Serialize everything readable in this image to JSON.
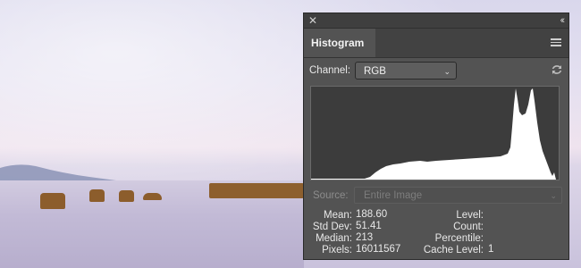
{
  "panel": {
    "tab_title": "Histogram",
    "icons": {
      "close": "close-icon",
      "collapse": "double-chevron-icon",
      "menu": "panel-menu-icon",
      "refresh": "refresh-icon"
    }
  },
  "channel": {
    "label": "Channel:",
    "value": "RGB"
  },
  "source": {
    "label": "Source:",
    "value": "Entire Image"
  },
  "stats_left": [
    {
      "label": "Mean:",
      "value": "188.60"
    },
    {
      "label": "Std Dev:",
      "value": "51.41"
    },
    {
      "label": "Median:",
      "value": "213"
    },
    {
      "label": "Pixels:",
      "value": "16011567"
    }
  ],
  "stats_right": [
    {
      "label": "Level:",
      "value": ""
    },
    {
      "label": "Count:",
      "value": ""
    },
    {
      "label": "Percentile:",
      "value": ""
    },
    {
      "label": "Cache Level:",
      "value": "1"
    }
  ],
  "colors": {
    "panel_bg": "#535353",
    "histogram_bg": "#3c3c3c",
    "histogram_fill": "#ffffff",
    "rock": "#8c5d2c"
  }
}
